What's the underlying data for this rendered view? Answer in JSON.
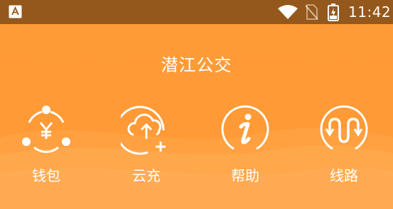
{
  "status_bar": {
    "time": "11:42",
    "icons": [
      "app-notification-icon",
      "wifi-icon",
      "no-sim-icon",
      "battery-charging-icon"
    ]
  },
  "header": {
    "title": "潜江公交"
  },
  "menu": {
    "items": [
      {
        "label": "钱包",
        "icon": "wallet-yen-icon"
      },
      {
        "label": "云充",
        "icon": "cloud-upload-plus-icon"
      },
      {
        "label": "帮助",
        "icon": "info-icon"
      },
      {
        "label": "线路",
        "icon": "route-icon"
      }
    ]
  },
  "colors": {
    "status_bar": "#95581C",
    "background": "#FF9A36",
    "icon": "#FFFFFF"
  }
}
